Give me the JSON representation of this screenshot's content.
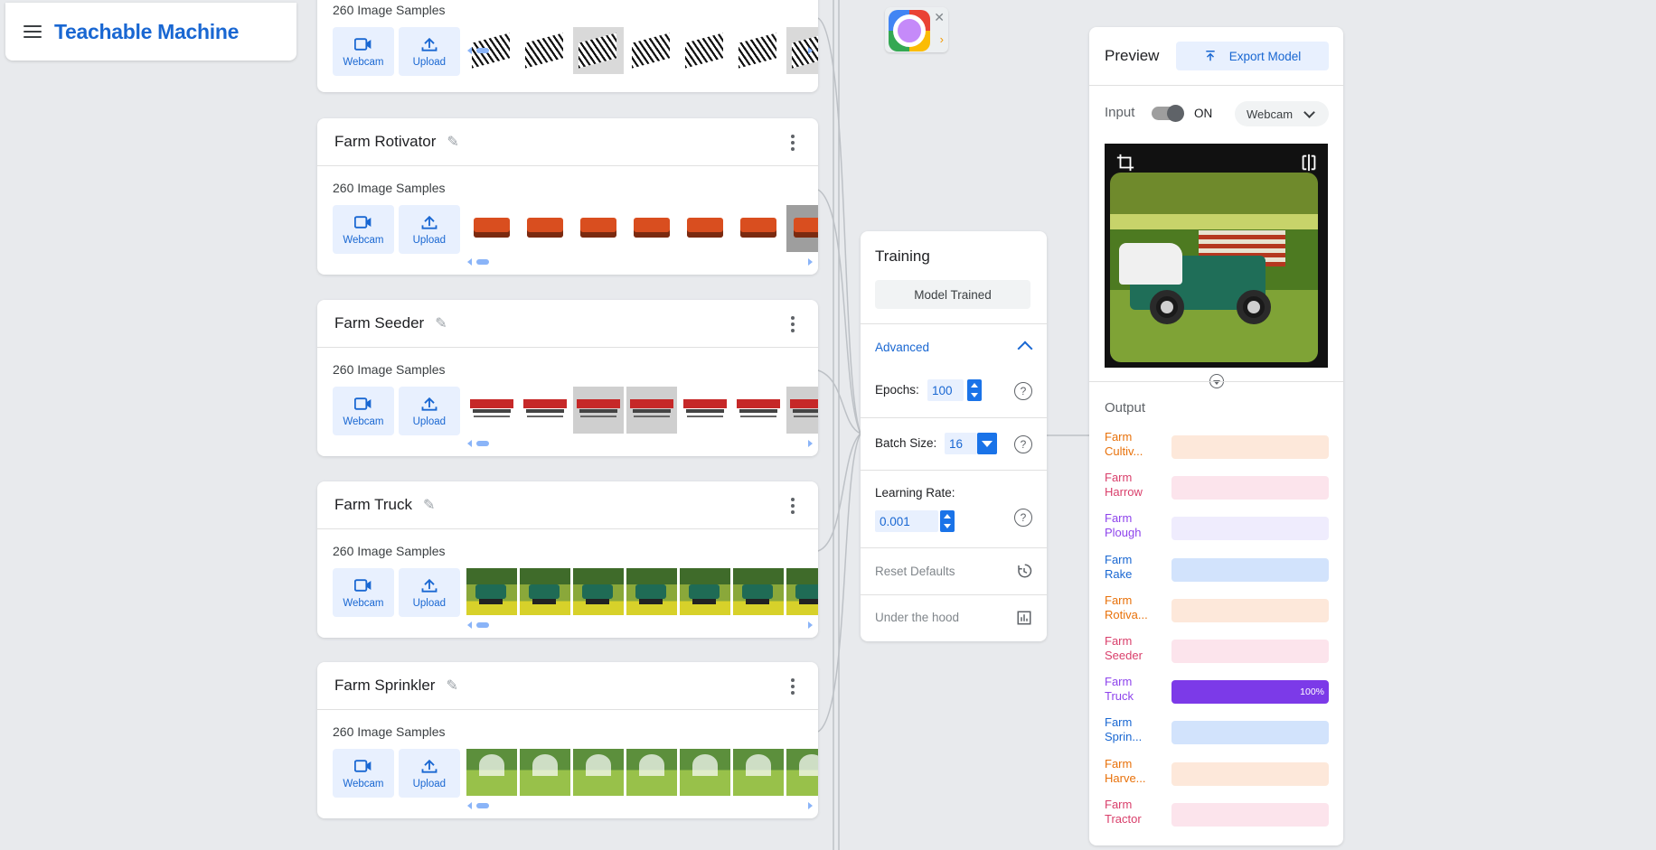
{
  "app": {
    "title": "Teachable Machine"
  },
  "classes": [
    {
      "name": "",
      "samples": "260 Image Samples",
      "webcam": "Webcam",
      "upload": "Upload",
      "thumb": "rake"
    },
    {
      "name": "Farm Rotivator",
      "samples": "260 Image Samples",
      "webcam": "Webcam",
      "upload": "Upload",
      "thumb": "rot"
    },
    {
      "name": "Farm  Seeder",
      "samples": "260 Image Samples",
      "webcam": "Webcam",
      "upload": "Upload",
      "thumb": "seed"
    },
    {
      "name": "Farm Truck",
      "samples": "260 Image Samples",
      "webcam": "Webcam",
      "upload": "Upload",
      "thumb": "truck"
    },
    {
      "name": "Farm Sprinkler",
      "samples": "260 Image Samples",
      "webcam": "Webcam",
      "upload": "Upload",
      "thumb": "spr"
    }
  ],
  "training": {
    "title": "Training",
    "button": "Model Trained",
    "advanced": "Advanced",
    "epochs_label": "Epochs:",
    "epochs": "100",
    "batch_label": "Batch Size:",
    "batch": "16",
    "lr_label": "Learning Rate:",
    "lr": "0.001",
    "reset": "Reset Defaults",
    "hood": "Under the hood"
  },
  "preview": {
    "title": "Preview",
    "export": "Export Model",
    "input_label": "Input",
    "toggle_state": "ON",
    "source": "Webcam",
    "output_label": "Output",
    "outputs": [
      {
        "line1": "Farm",
        "line2": "Cultiv...",
        "color": "#e8710a",
        "track": "#fde8da",
        "value": 0
      },
      {
        "line1": "Farm",
        "line2": "Harrow",
        "color": "#d93f6b",
        "track": "#fce4ec",
        "value": 0
      },
      {
        "line1": "Farm",
        "line2": "Plough",
        "color": "#8e44ec",
        "track": "#efecfd",
        "value": 0
      },
      {
        "line1": "Farm",
        "line2": "Rake",
        "color": "#1967d2",
        "track": "#d2e3fc",
        "value": 0
      },
      {
        "line1": "Farm",
        "line2": "Rotiva...",
        "color": "#e8710a",
        "track": "#fde8da",
        "value": 0
      },
      {
        "line1": "Farm",
        "line2": "Seeder",
        "color": "#d93f6b",
        "track": "#fce4ec",
        "value": 0
      },
      {
        "line1": "Farm",
        "line2": "Truck",
        "color": "#8e44ec",
        "track": "#efecfd",
        "fill": "#7c3ae8",
        "value": 100,
        "label": "100%"
      },
      {
        "line1": "Farm",
        "line2": "Sprin...",
        "color": "#1967d2",
        "track": "#d2e3fc",
        "value": 0
      },
      {
        "line1": "Farm",
        "line2": "Harve...",
        "color": "#e8710a",
        "track": "#fde8da",
        "value": 0
      },
      {
        "line1": "Farm",
        "line2": "Tractor",
        "color": "#d93f6b",
        "track": "#fce4ec",
        "value": 0
      }
    ]
  }
}
